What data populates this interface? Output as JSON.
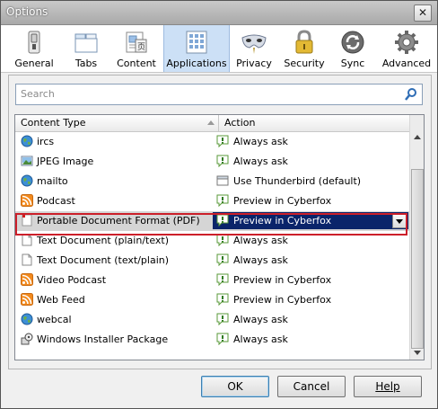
{
  "window": {
    "title": "Options"
  },
  "toolbar": {
    "tabs": [
      {
        "label": "General",
        "icon": "general-switch-icon"
      },
      {
        "label": "Tabs",
        "icon": "tabs-icon"
      },
      {
        "label": "Content",
        "icon": "content-icon"
      },
      {
        "label": "Applications",
        "icon": "applications-icon",
        "active": true
      },
      {
        "label": "Privacy",
        "icon": "privacy-mask-icon"
      },
      {
        "label": "Security",
        "icon": "security-lock-icon"
      },
      {
        "label": "Sync",
        "icon": "sync-icon"
      },
      {
        "label": "Advanced",
        "icon": "advanced-gear-icon"
      }
    ]
  },
  "search": {
    "placeholder": "Search"
  },
  "list": {
    "columns": {
      "content_type": "Content Type",
      "action": "Action"
    },
    "rows": [
      {
        "type": "ircs",
        "type_icon": "globe-icon",
        "action": "Always ask",
        "action_icon": "ask-icon"
      },
      {
        "type": "JPEG Image",
        "type_icon": "image-icon",
        "action": "Always ask",
        "action_icon": "ask-icon"
      },
      {
        "type": "mailto",
        "type_icon": "globe-icon",
        "action": "Use Thunderbird (default)",
        "action_icon": "app-icon"
      },
      {
        "type": "Podcast",
        "type_icon": "rss-icon",
        "action": "Preview in Cyberfox",
        "action_icon": "ask-icon"
      },
      {
        "type": "Portable Document Format (PDF)",
        "type_icon": "pdf-icon",
        "action": "Preview in Cyberfox",
        "action_icon": "ask-icon",
        "selected": true
      },
      {
        "type": "Text Document (plain/text)",
        "type_icon": "doc-icon",
        "action": "Always ask",
        "action_icon": "ask-icon"
      },
      {
        "type": "Text Document (text/plain)",
        "type_icon": "doc-icon",
        "action": "Always ask",
        "action_icon": "ask-icon"
      },
      {
        "type": "Video Podcast",
        "type_icon": "rss-icon",
        "action": "Preview in Cyberfox",
        "action_icon": "ask-icon"
      },
      {
        "type": "Web Feed",
        "type_icon": "rss-icon",
        "action": "Preview in Cyberfox",
        "action_icon": "ask-icon"
      },
      {
        "type": "webcal",
        "type_icon": "globe-icon",
        "action": "Always ask",
        "action_icon": "ask-icon"
      },
      {
        "type": "Windows Installer Package",
        "type_icon": "installer-icon",
        "action": "Always ask",
        "action_icon": "ask-icon"
      }
    ]
  },
  "buttons": {
    "ok": "OK",
    "cancel": "Cancel",
    "help": "Help"
  },
  "colors": {
    "selection": "#0a246a",
    "highlight_border": "#cc1f2a",
    "active_tab": "#cce0f6"
  }
}
